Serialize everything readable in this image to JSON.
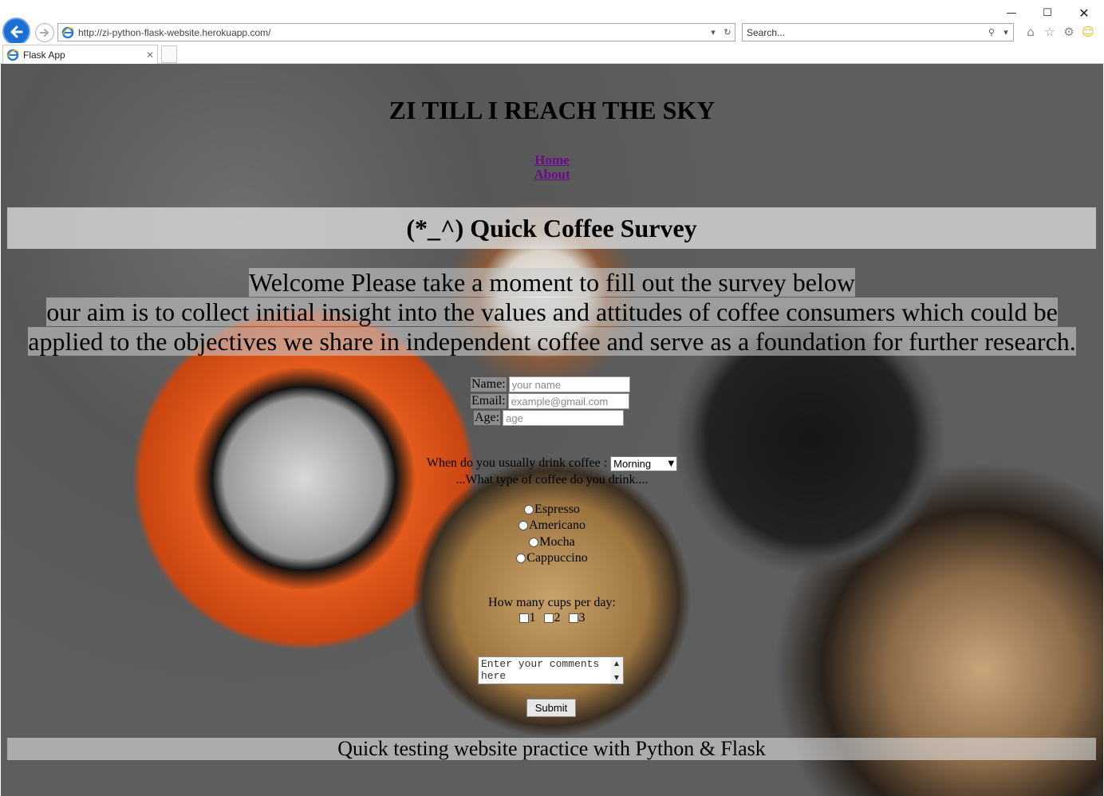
{
  "browser": {
    "url": "http://zi-python-flask-website.herokuapp.com/",
    "search_placeholder": "Search...",
    "tab_title": "Flask App",
    "icons": [
      "back-icon",
      "forward-icon",
      "ie-icon",
      "refresh-icon",
      "search-icon",
      "home-icon",
      "favorites-star-icon",
      "settings-gear-icon",
      "smiley-feedback-icon"
    ]
  },
  "page": {
    "site_title": "ZI TILL I REACH THE SKY",
    "nav": {
      "home": "Home",
      "about": "About"
    },
    "survey_title": "(*_^) Quick Coffee Survey",
    "intro": {
      "line1": "Welcome Please take a moment to fill out the survey below",
      "line2": "our aim is to collect initial insight into the values and attitudes of coffee consumers which could be",
      "line3": "applied to the objectives we share in independent coffee and serve as a foundation for further research."
    },
    "form": {
      "name_label": "Name:",
      "name_placeholder": "your name",
      "email_label": "Email:",
      "email_placeholder": "example@gmail.com",
      "age_label": "Age:",
      "age_placeholder": "age",
      "when_label": "When do you usually drink coffee :",
      "when_selected": "Morning",
      "type_label": "...What type of coffee do you drink....",
      "coffee_types": [
        "Espresso",
        "Americano",
        "Mocha",
        "Cappuccino"
      ],
      "cups_label": "How many cups per day:",
      "cups_options": [
        "1",
        "2",
        "3"
      ],
      "comments_placeholder": "Enter your comments here",
      "submit_label": "Submit"
    },
    "footer": "Quick testing website practice with Python & Flask"
  }
}
